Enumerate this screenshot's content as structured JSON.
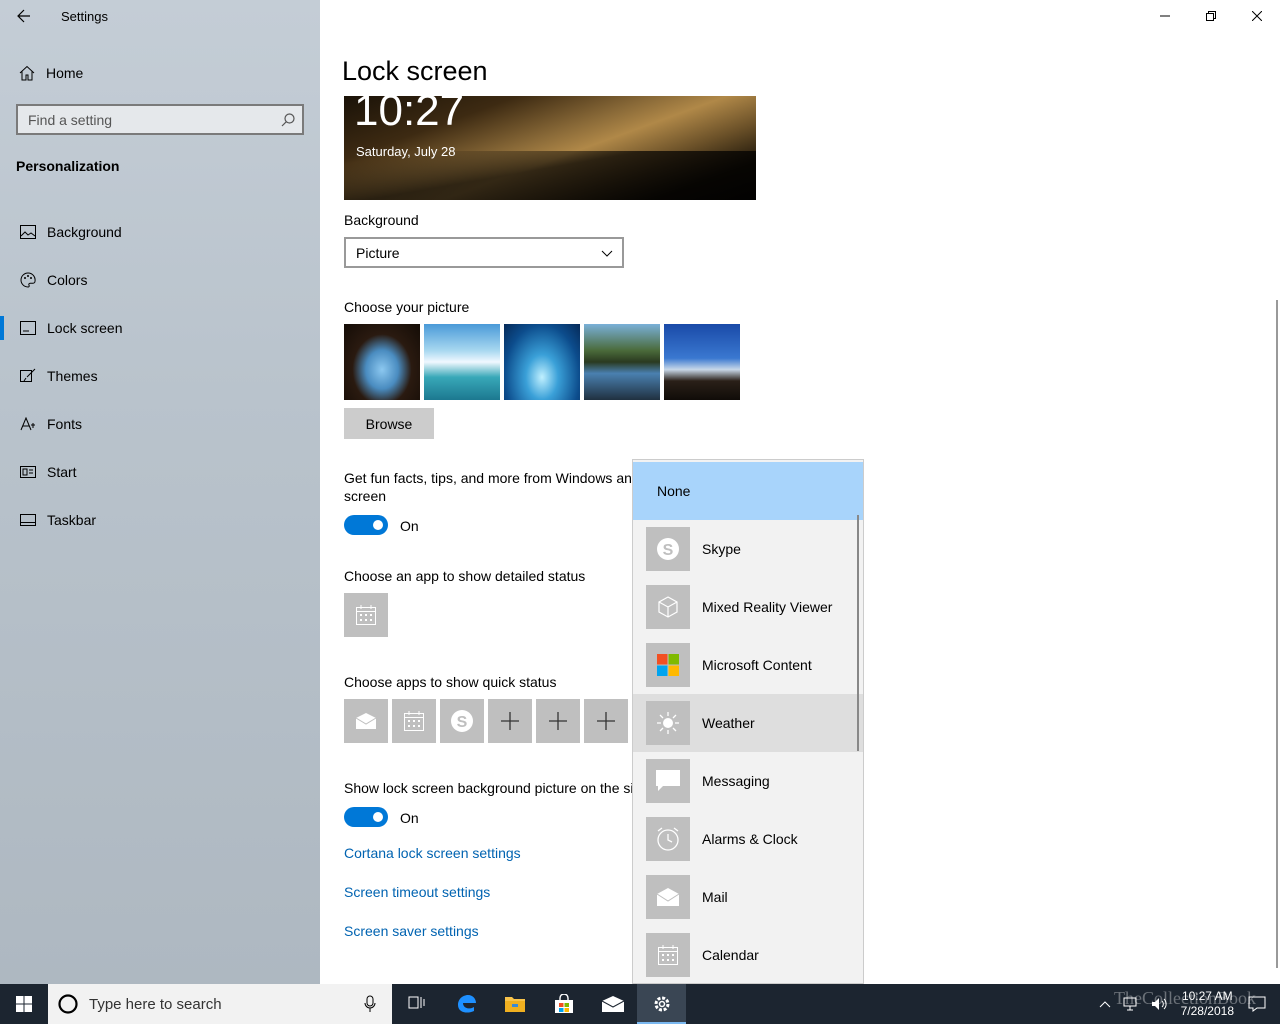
{
  "window": {
    "app_title": "Settings"
  },
  "sidebar": {
    "home_label": "Home",
    "search_placeholder": "Find a setting",
    "section": "Personalization",
    "items": [
      {
        "label": "Background",
        "icon": "picture-icon"
      },
      {
        "label": "Colors",
        "icon": "palette-icon"
      },
      {
        "label": "Lock screen",
        "icon": "lock-screen-icon",
        "active": true
      },
      {
        "label": "Themes",
        "icon": "brush-icon"
      },
      {
        "label": "Fonts",
        "icon": "font-icon"
      },
      {
        "label": "Start",
        "icon": "start-icon"
      },
      {
        "label": "Taskbar",
        "icon": "taskbar-icon"
      }
    ]
  },
  "main": {
    "title": "Lock screen",
    "preview": {
      "time": "10:27",
      "date": "Saturday, July 28"
    },
    "background_label": "Background",
    "background_value": "Picture",
    "choose_picture_label": "Choose your picture",
    "browse_label": "Browse",
    "fun_facts_line1": "Get fun facts, tips, and more from Windows and",
    "fun_facts_line2": "screen",
    "fun_facts_state": "On",
    "detailed_status_label": "Choose an app to show detailed status",
    "quick_status_label": "Choose apps to show quick status",
    "show_bg_label": "Show lock screen background picture on the si",
    "show_bg_state": "On",
    "links": {
      "cortana": "Cortana lock screen settings",
      "timeout": "Screen timeout settings",
      "saver": "Screen saver settings"
    }
  },
  "flyout": {
    "items": [
      {
        "label": "None"
      },
      {
        "label": "Skype",
        "icon": "skype-icon"
      },
      {
        "label": "Mixed Reality Viewer",
        "icon": "cube-icon"
      },
      {
        "label": "Microsoft Content",
        "icon": "microsoft-logo-icon"
      },
      {
        "label": "Weather",
        "icon": "sun-icon"
      },
      {
        "label": "Messaging",
        "icon": "chat-icon"
      },
      {
        "label": "Alarms & Clock",
        "icon": "alarm-icon"
      },
      {
        "label": "Mail",
        "icon": "mail-icon"
      },
      {
        "label": "Calendar",
        "icon": "calendar-icon"
      }
    ]
  },
  "taskbar": {
    "search_placeholder": "Type here to search",
    "clock_time": "10:27 AM",
    "clock_date": "7/28/2018",
    "watermark": "TheCollectionBook"
  },
  "colors": {
    "accent": "#0078d7",
    "link": "#0063b1",
    "flyout_selected": "#a8d4fb"
  }
}
